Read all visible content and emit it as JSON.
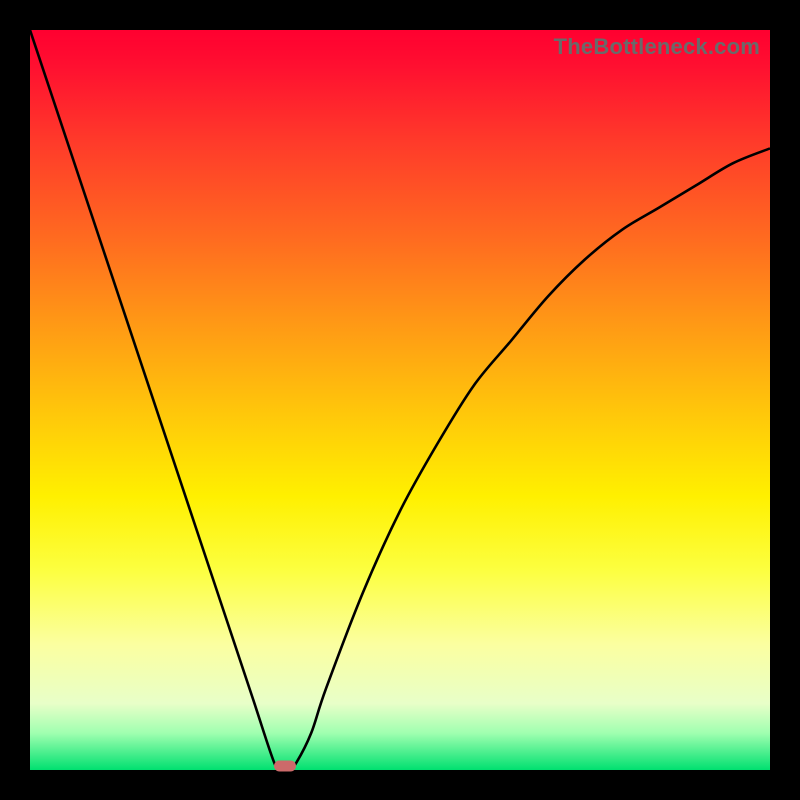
{
  "attribution": "TheBottleneck.com",
  "colors": {
    "frame": "#000000",
    "curve": "#000000",
    "marker": "#cc6a6a",
    "gradient_top": "#ff0030",
    "gradient_bottom": "#00e070"
  },
  "chart_data": {
    "type": "line",
    "title": "",
    "xlabel": "",
    "ylabel": "",
    "xlim": [
      0,
      100
    ],
    "ylim": [
      0,
      100
    ],
    "grid": false,
    "legend": false,
    "series": [
      {
        "name": "bottleneck-curve",
        "x": [
          0,
          5,
          10,
          15,
          20,
          25,
          30,
          33,
          34,
          35,
          36,
          38,
          40,
          45,
          50,
          55,
          60,
          65,
          70,
          75,
          80,
          85,
          90,
          95,
          100
        ],
        "values": [
          100,
          85,
          70,
          55,
          40,
          25,
          10,
          1,
          0,
          0,
          1,
          5,
          11,
          24,
          35,
          44,
          52,
          58,
          64,
          69,
          73,
          76,
          79,
          82,
          84
        ]
      }
    ],
    "annotations": [
      {
        "name": "min-marker",
        "x": 34.5,
        "y": 0
      }
    ]
  }
}
